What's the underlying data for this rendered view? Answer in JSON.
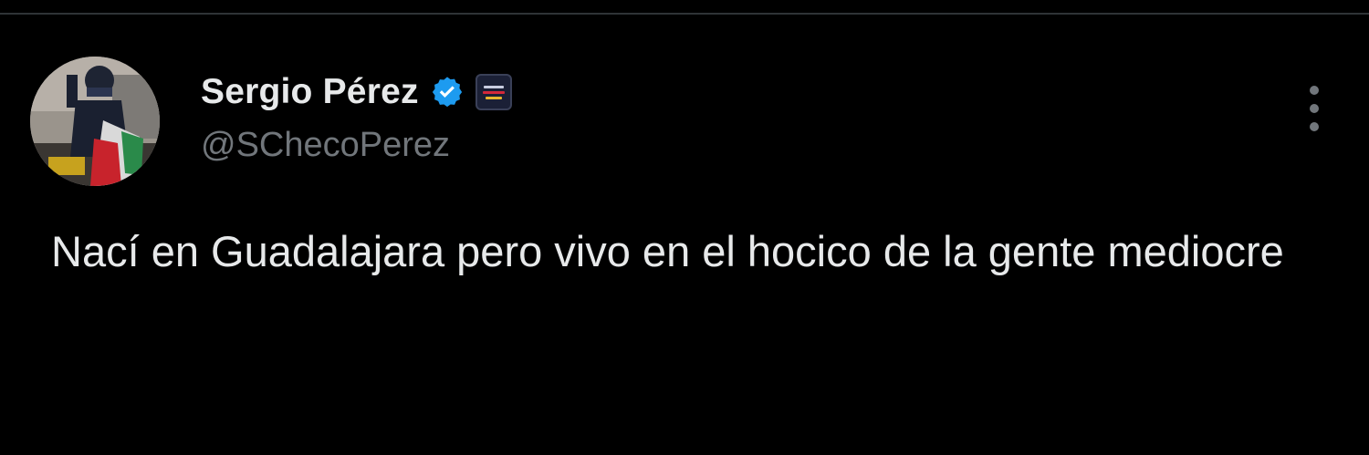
{
  "tweet": {
    "author": {
      "display_name": "Sergio Pérez",
      "handle": "@SChecoPerez",
      "verified_icon": "verified-badge-icon",
      "affiliate_icon": "team-affiliate-badge-icon"
    },
    "text": "Nací en Guadalajara pero vivo en el hocico de la gente mediocre",
    "menu_icon": "more-options-icon"
  },
  "colors": {
    "background": "#000000",
    "text_primary": "#e7e9ea",
    "text_secondary": "#71767b",
    "verified_blue": "#1d9bf0",
    "divider": "#2f3336"
  }
}
